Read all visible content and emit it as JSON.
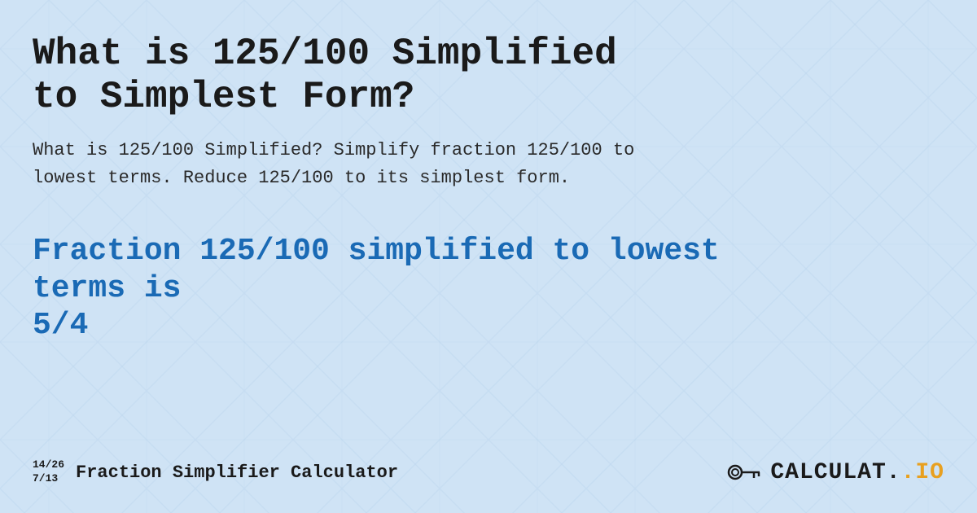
{
  "page": {
    "title": "What is 125/100 Simplified to Simplest Form?",
    "description_line1": "What is 125/100 Simplified? Simplify fraction 125/100 to",
    "description_line2": "lowest terms. Reduce 125/100 to its simplest form.",
    "result_line1": "Fraction 125/100 simplified to lowest terms is",
    "result_line2": "5/4"
  },
  "footer": {
    "fraction1": "14/26",
    "fraction2": "7/13",
    "brand_label": "Fraction Simplifier Calculator",
    "logo_text_main": "CALCULAT",
    "logo_text_suffix": ".IO"
  },
  "background": {
    "color": "#cce0f5"
  }
}
